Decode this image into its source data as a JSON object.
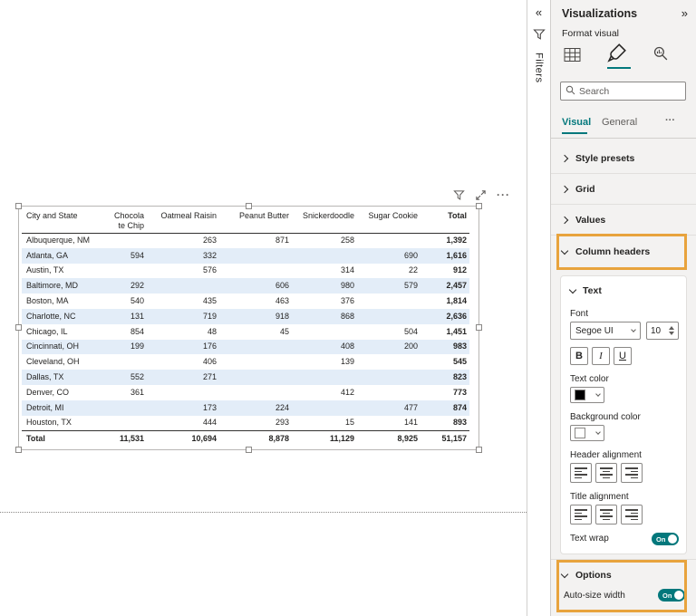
{
  "canvas": {
    "table": {
      "header_city": "City and State",
      "header_cols": [
        "Chocola te Chip",
        "Oatmeal Raisin",
        "Peanut Butter",
        "Snickerdoodle",
        "Sugar Cookie",
        "Total"
      ],
      "rows": [
        {
          "city": "Albuquerque, NM",
          "v": [
            "",
            "263",
            "871",
            "258",
            "",
            "1,392"
          ]
        },
        {
          "city": "Atlanta, GA",
          "v": [
            "594",
            "332",
            "",
            "",
            "690",
            "1,616"
          ]
        },
        {
          "city": "Austin, TX",
          "v": [
            "",
            "576",
            "",
            "314",
            "22",
            "912"
          ]
        },
        {
          "city": "Baltimore, MD",
          "v": [
            "292",
            "",
            "606",
            "980",
            "579",
            "2,457"
          ]
        },
        {
          "city": "Boston, MA",
          "v": [
            "540",
            "435",
            "463",
            "376",
            "",
            "1,814"
          ]
        },
        {
          "city": "Charlotte, NC",
          "v": [
            "131",
            "719",
            "918",
            "868",
            "",
            "2,636"
          ]
        },
        {
          "city": "Chicago, IL",
          "v": [
            "854",
            "48",
            "45",
            "",
            "504",
            "1,451"
          ]
        },
        {
          "city": "Cincinnati, OH",
          "v": [
            "199",
            "176",
            "",
            "408",
            "200",
            "983"
          ]
        },
        {
          "city": "Cleveland, OH",
          "v": [
            "",
            "406",
            "",
            "139",
            "",
            "545"
          ]
        },
        {
          "city": "Dallas, TX",
          "v": [
            "552",
            "271",
            "",
            "",
            "",
            "823"
          ]
        },
        {
          "city": "Denver, CO",
          "v": [
            "361",
            "",
            "",
            "412",
            "",
            "773"
          ]
        },
        {
          "city": "Detroit, MI",
          "v": [
            "",
            "173",
            "224",
            "",
            "477",
            "874"
          ]
        },
        {
          "city": "Houston, TX",
          "v": [
            "",
            "444",
            "293",
            "15",
            "141",
            "893"
          ]
        }
      ],
      "total_label": "Total",
      "total_values": [
        "11,531",
        "10,694",
        "8,878",
        "11,129",
        "8,925",
        "51,157"
      ]
    }
  },
  "filters_pane": {
    "label": "Filters"
  },
  "viz_pane": {
    "title": "Visualizations",
    "subtitle": "Format visual",
    "search_placeholder": "Search",
    "tab_visual": "Visual",
    "tab_general": "General",
    "section_style_presets": "Style presets",
    "section_grid": "Grid",
    "section_values": "Values",
    "section_column_headers": "Column headers",
    "section_options": "Options",
    "text_card": {
      "title": "Text",
      "font_label": "Font",
      "font_value": "Segoe UI",
      "font_size": "10",
      "bold_label": "B",
      "italic_label": "I",
      "underline_label": "U",
      "text_color_label": "Text color",
      "background_color_label": "Background color",
      "header_alignment_label": "Header alignment",
      "title_alignment_label": "Title alignment",
      "text_wrap_label": "Text wrap",
      "text_wrap_state": "On"
    },
    "options_card": {
      "auto_size_label": "Auto-size width",
      "auto_size_state": "On"
    }
  },
  "icons": {
    "collapse_left": "«",
    "collapse_right": "»",
    "more": "···"
  },
  "colors": {
    "accent_teal": "#03787c",
    "highlight_orange": "#e8a33d",
    "row_stripe_blue": "#e3edf8",
    "text_color_swatch": "#000000",
    "background_color_swatch": "#ffffff"
  }
}
